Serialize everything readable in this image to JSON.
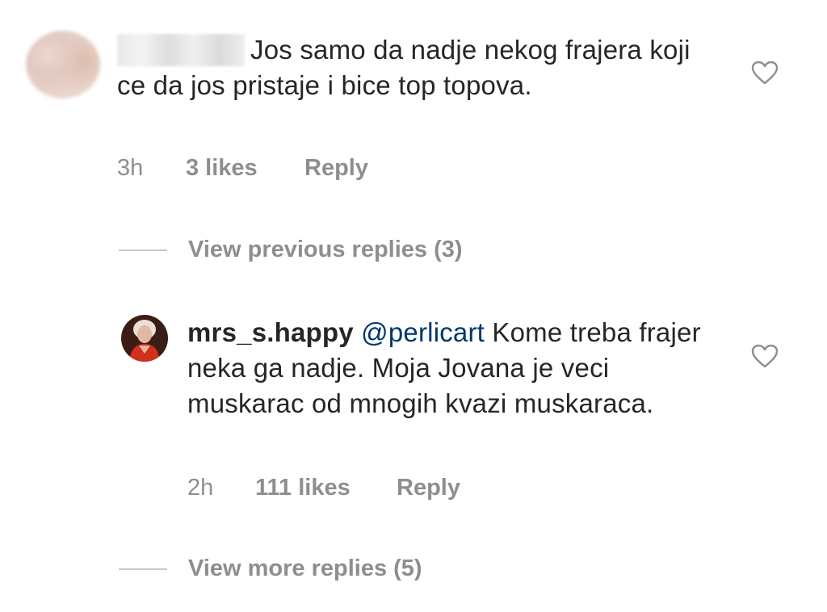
{
  "comments": [
    {
      "text": "Jos samo da nadje nekog frajera koji ce da jos pristaje i bice top topova.",
      "time": "3h",
      "likes": "3 likes",
      "reply": "Reply",
      "like_icon": "heart-outline-icon"
    },
    {
      "username": "mrs_s.happy",
      "mention": "@perlicart",
      "text": " Kome treba frajer neka ga nadje. Moja Jovana je veci muskarac od mnogih kvazi muskaraca.",
      "time": "2h",
      "likes": "111 likes",
      "reply": "Reply",
      "like_icon": "heart-outline-icon"
    }
  ],
  "threads": {
    "view_previous": "View previous replies (3)",
    "view_more": "View more replies (5)"
  },
  "colors": {
    "text": "#262626",
    "muted": "#8e8e8e",
    "mention": "#00376b",
    "divider": "#c7c7c7"
  }
}
